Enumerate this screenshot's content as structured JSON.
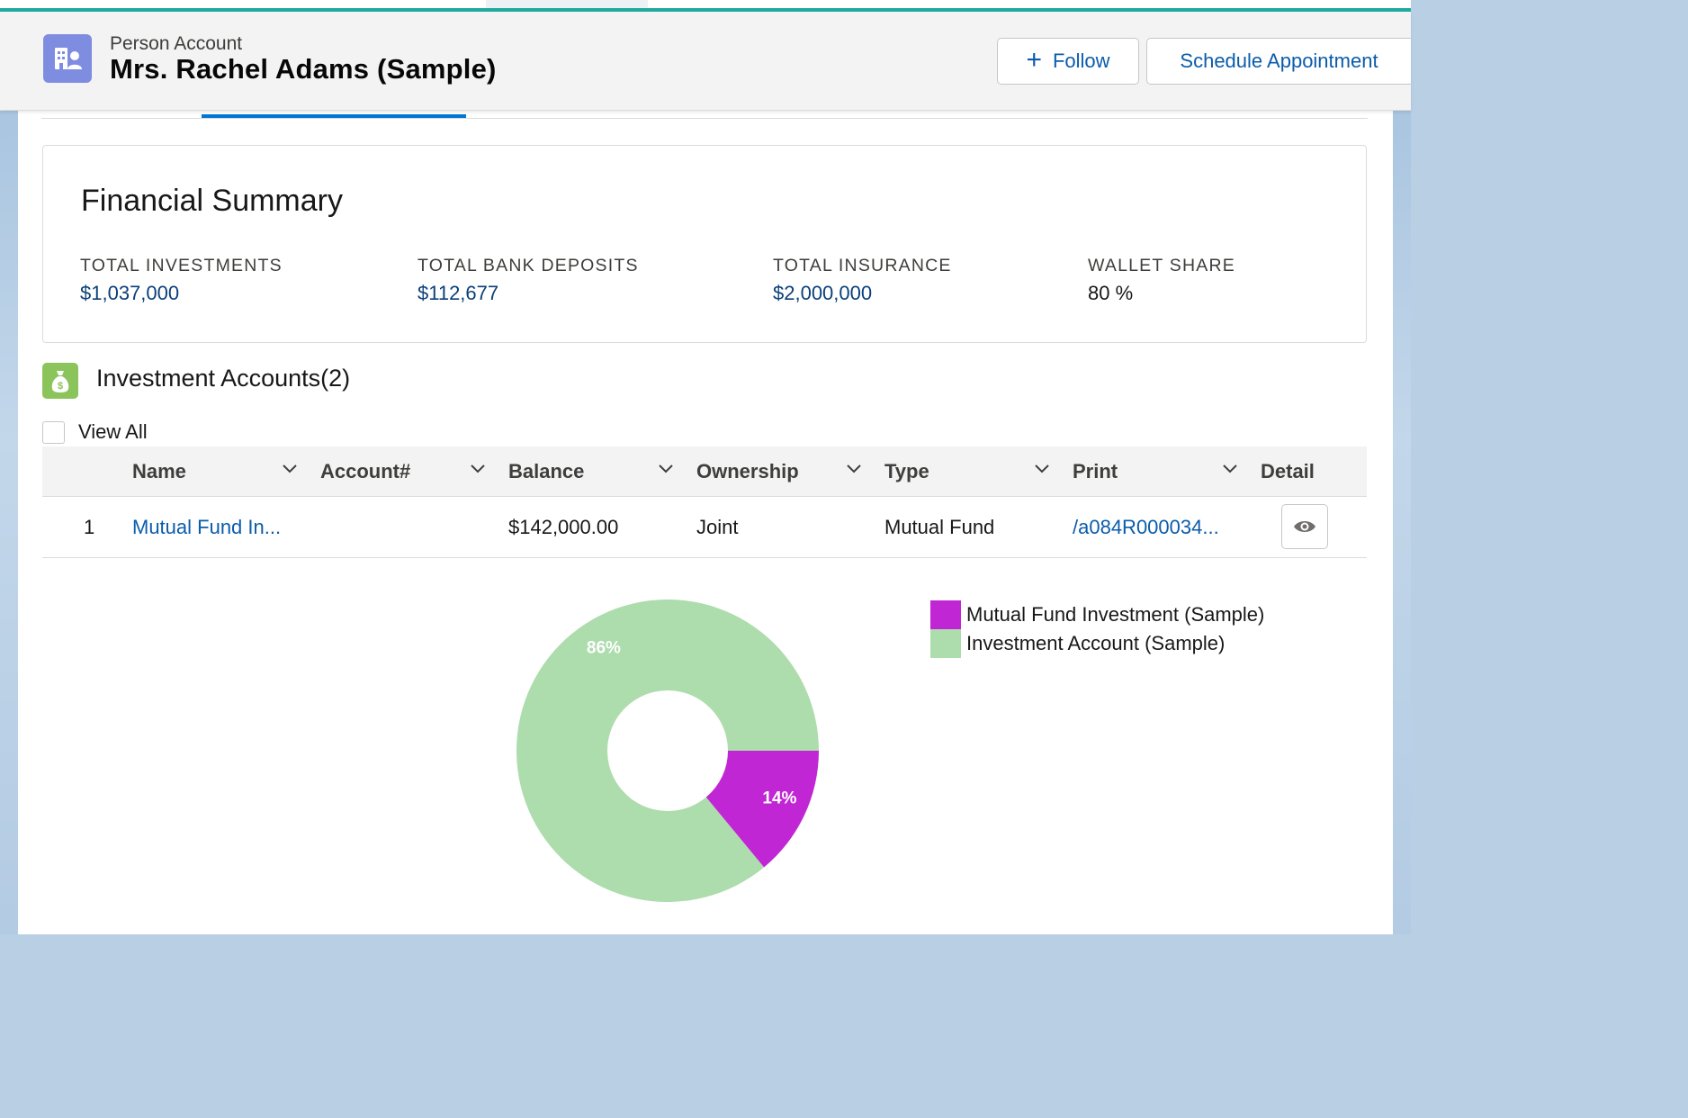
{
  "header": {
    "object_label": "Person Account",
    "record_title": "Mrs. Rachel Adams (Sample)",
    "follow_label": "Follow",
    "schedule_label": "Schedule Appointment"
  },
  "summary": {
    "title": "Financial Summary",
    "metrics": [
      {
        "label": "TOTAL INVESTMENTS",
        "value": "$1,037,000"
      },
      {
        "label": "TOTAL BANK DEPOSITS",
        "value": "$112,677"
      },
      {
        "label": "TOTAL INSURANCE",
        "value": "$2,000,000"
      },
      {
        "label": "WALLET SHARE",
        "value": "80 %"
      }
    ]
  },
  "investments": {
    "title": "Investment Accounts(2)",
    "view_all": "View All",
    "columns": [
      "Name",
      "Account#",
      "Balance",
      "Ownership",
      "Type",
      "Print",
      "Detail"
    ],
    "rows": [
      {
        "num": "1",
        "name": "Mutual Fund In...",
        "account": "",
        "balance": "$142,000.00",
        "ownership": "Joint",
        "type": "Mutual Fund",
        "print": "/a084R000034..."
      }
    ]
  },
  "chart_data": {
    "type": "pie",
    "donut": true,
    "categories": [
      "Mutual Fund Investment (Sample)",
      "Investment Account (Sample)"
    ],
    "values": [
      14,
      86
    ],
    "labels": [
      "14%",
      "86%"
    ],
    "colors": [
      "#c026d3",
      "#addcad"
    ],
    "legend_position": "top-right"
  }
}
